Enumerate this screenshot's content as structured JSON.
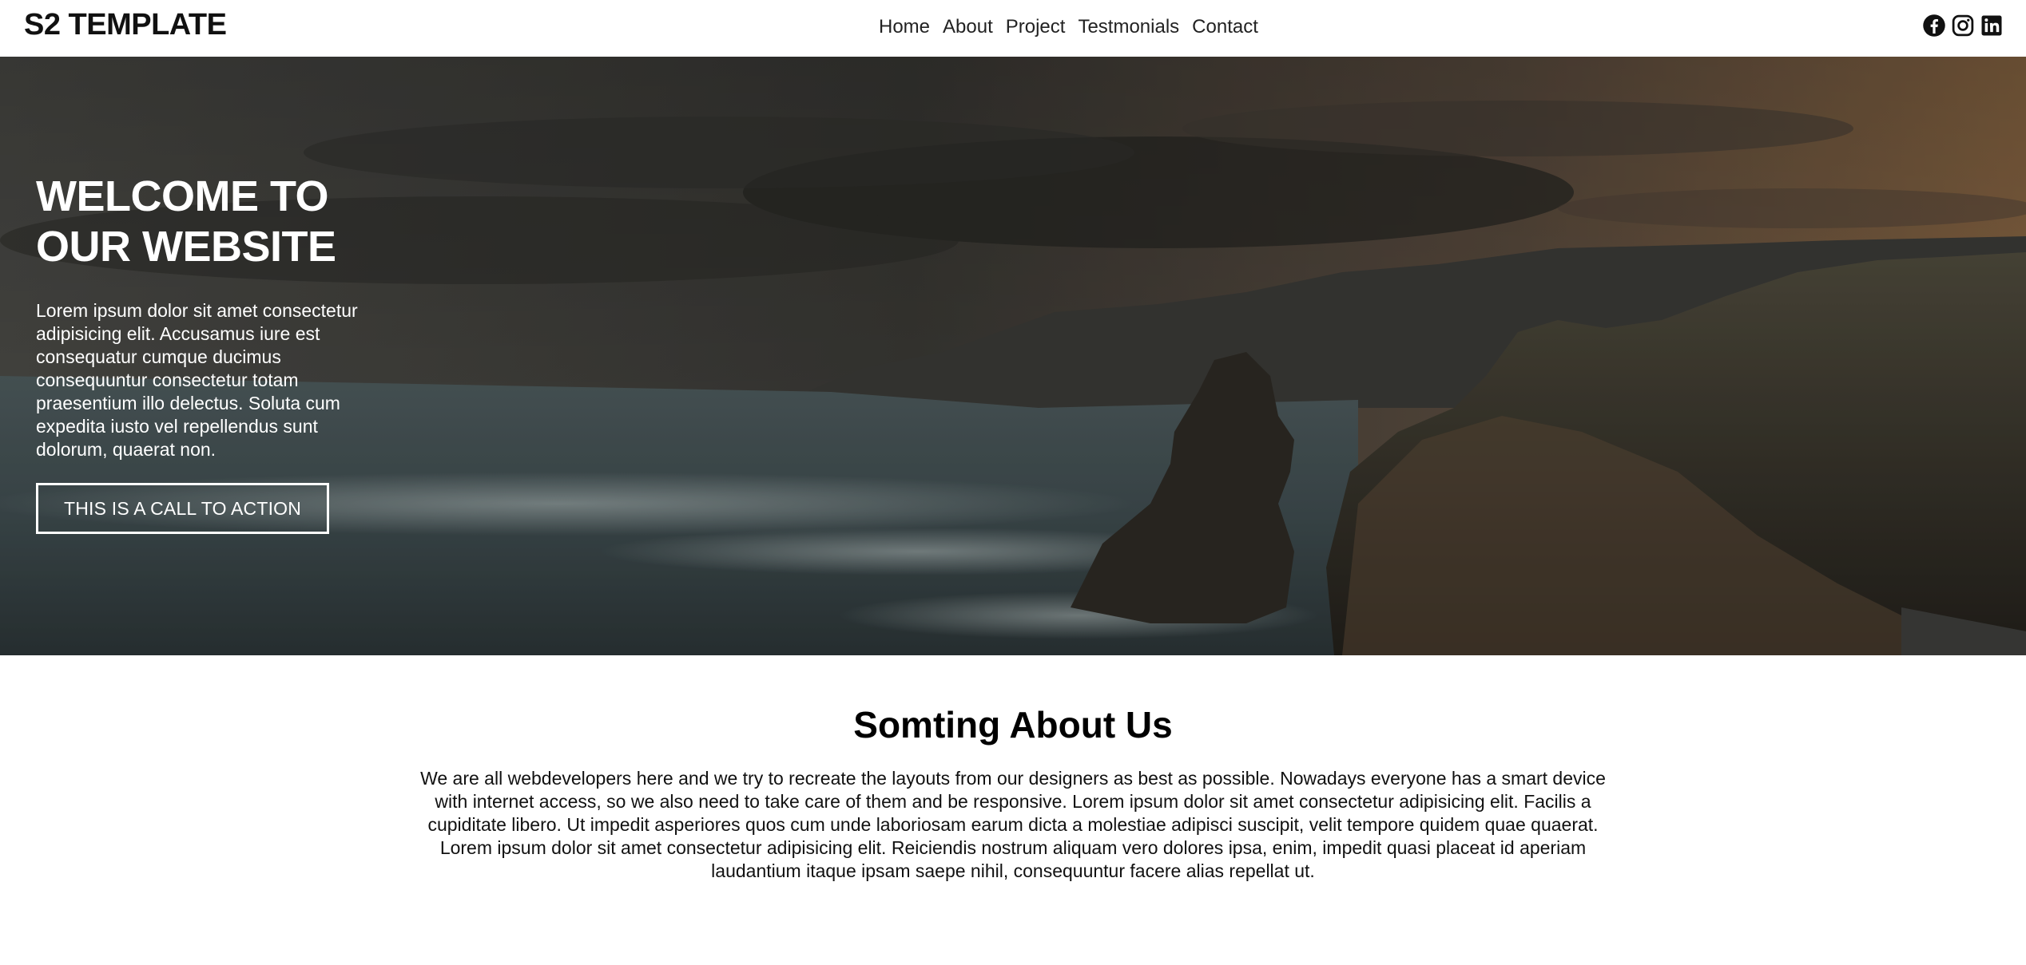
{
  "navbar": {
    "brand": "S2 TEMPLATE",
    "links": [
      "Home",
      "About",
      "Project",
      "Testmonials",
      "Contact"
    ],
    "social_icons": [
      "facebook-icon",
      "instagram-icon",
      "linkedin-icon"
    ]
  },
  "hero": {
    "title": "WELCOME TO OUR WEBSITE",
    "text": "Lorem ipsum dolor sit amet consectetur adipisicing elit. Accusamus iure est consequatur cumque ducimus consequuntur consectetur totam praesentium illo delectus. Soluta cum expedita iusto vel repellendus sunt dolorum, quaerat non.",
    "cta_label": "THIS IS A CALL TO ACTION"
  },
  "about": {
    "title": "Somting About Us",
    "text": "We are all webdevelopers here and we try to recreate the layouts from our designers as best as possible. Nowadays everyone has a smart device with internet access, so we also need to take care of them and be responsive. Lorem ipsum dolor sit amet consectetur adipisicing elit. Facilis a cupiditate libero. Ut impedit asperiores quos cum unde laboriosam earum dicta a molestiae adipisci suscipit, velit tempore quidem quae quaerat. Lorem ipsum dolor sit amet consectetur adipisicing elit. Reiciendis nostrum aliquam vero dolores ipsa, enim, impedit quasi placeat id aperiam laudantium itaque ipsam saepe nihil, consequuntur facere alias repellat ut."
  },
  "colors": {
    "nav_bg": "#ffffff",
    "text": "#111111",
    "hero_overlay_text": "#ffffff"
  }
}
